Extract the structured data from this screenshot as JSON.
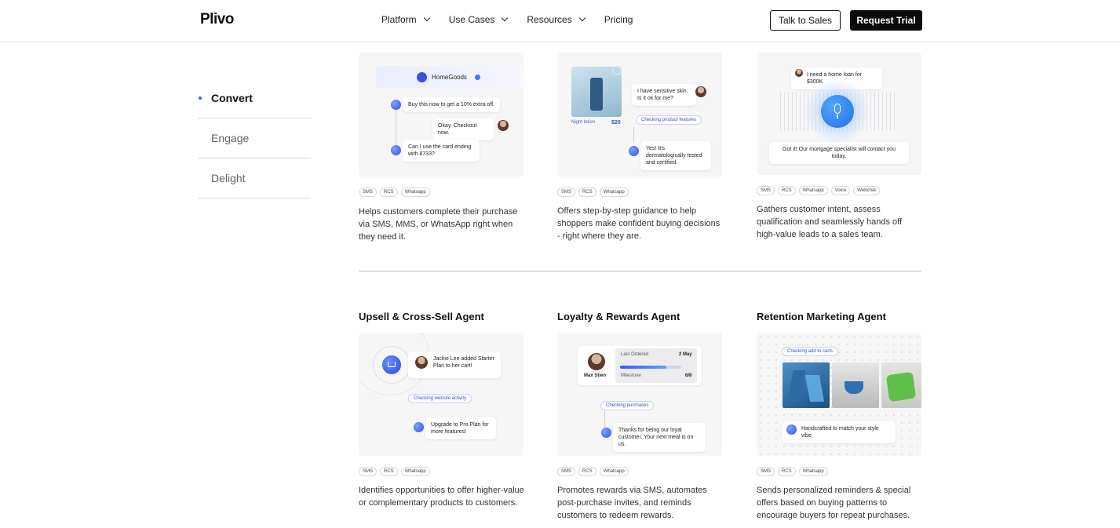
{
  "header": {
    "logo": "Plivo",
    "nav": [
      {
        "label": "Platform",
        "has_dropdown": true
      },
      {
        "label": "Use Cases",
        "has_dropdown": true
      },
      {
        "label": "Resources",
        "has_dropdown": true
      },
      {
        "label": "Pricing",
        "has_dropdown": false
      }
    ],
    "talk_label": "Talk to Sales",
    "trial_label": "Request Trial"
  },
  "sidebar": {
    "items": [
      {
        "label": "Convert",
        "active": true
      },
      {
        "label": "Engage",
        "active": false
      },
      {
        "label": "Delight",
        "active": false
      }
    ]
  },
  "cards": [
    {
      "title": "",
      "chips": [
        "SMS",
        "RCS",
        "Whatsapp"
      ],
      "desc": "Helps customers complete their purchase via SMS, MMS, or WhatsApp right when they need it.",
      "illus": {
        "brand": "HomeGoods",
        "msg1": "Buy this now to get a 10% extra off.",
        "msg2": "Okay. Checkout now.",
        "msg3": "Can I use the card ending with 8733?"
      }
    },
    {
      "title": "",
      "chips": [
        "SMS",
        "RCS",
        "Whatsapp"
      ],
      "desc": "Offers step-by-step guidance to help shoppers make confident buying decisions - right where they are.",
      "illus": {
        "product_name": "Night lotion",
        "price": "$20",
        "msg1": "I have sensitive skin. Is it ok for me?",
        "status": "Checking product features",
        "msg2": "Yes! It's dermatologically tested and certified."
      }
    },
    {
      "title": "",
      "chips": [
        "SMS",
        "RCS",
        "Whatsapp",
        "Voice",
        "Webchat"
      ],
      "desc": "Gathers customer intent, assess qualification and seamlessly hands off high-value leads to a sales team.",
      "illus": {
        "msg1": "I need a home loan for $300K",
        "msg2": "Got it! Our mortgage specialist will contact you today."
      }
    },
    {
      "title": "Upsell & Cross-Sell Agent",
      "chips": [
        "SMS",
        "RCS",
        "Whatsapp"
      ],
      "desc": "Identifies opportunities to offer higher-value or complementary products to customers.",
      "illus": {
        "msg1": "Jackie Lee added Starter Plan to her cart!",
        "status": "Checking website activity",
        "msg2": "Upgrade to Pro Plan for more features!"
      }
    },
    {
      "title": "Loyalty & Rewards Agent",
      "chips": [
        "SMS",
        "RCS",
        "Whatsapp"
      ],
      "desc": "Promotes rewards via SMS, automates post-purchase invites, and reminds customers to redeem rewards.",
      "illus": {
        "customer": "Max Stien",
        "last_ordered_label": "Last Ordered",
        "last_ordered_value": "2 May",
        "milestone_label": "Milestone",
        "milestone_value": "6/8",
        "milestone_progress": 0.75,
        "status": "Checking purchases",
        "msg": "Thanks for being our loyal customer. Your next meal is on us."
      }
    },
    {
      "title": "Retention Marketing Agent",
      "chips": [
        "SMS",
        "RCS",
        "Whatsapp"
      ],
      "desc": "Sends personalized reminders & special offers based on buying patterns to encourage buyers for repeat purchases.",
      "illus": {
        "status": "Checking add to carts",
        "msg": "Handcrafted to match your style vibe"
      }
    }
  ]
}
